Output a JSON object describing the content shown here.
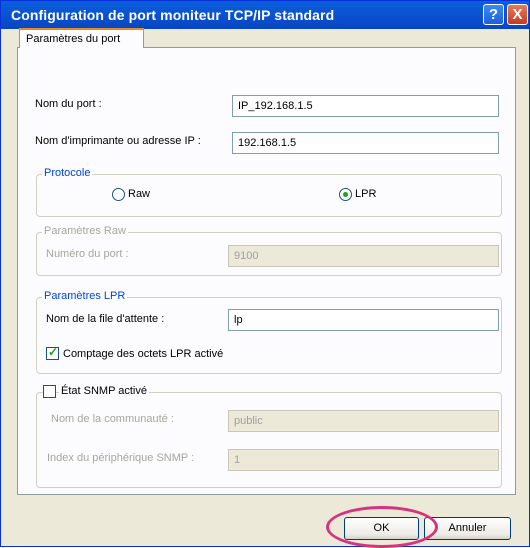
{
  "window": {
    "title": "Configuration de port moniteur TCP/IP standard",
    "help_symbol": "?",
    "close_symbol": "X"
  },
  "tab": {
    "label": "Paramètres du port"
  },
  "port": {
    "name_label": "Nom du port :",
    "name_value": "IP_192.168.1.5",
    "address_label": "Nom d'imprimante ou adresse IP :",
    "address_value": "192.168.1.5"
  },
  "protocol": {
    "legend": "Protocole",
    "raw_label": "Raw",
    "lpr_label": "LPR",
    "selected": "LPR"
  },
  "raw_settings": {
    "legend": "Paramètres Raw",
    "port_number_label": "Numéro du port :",
    "port_number_value": "9100"
  },
  "lpr_settings": {
    "legend": "Paramètres LPR",
    "queue_label": "Nom de la file d'attente :",
    "queue_value": "lp",
    "byte_count_label": "Comptage des octets LPR activé",
    "byte_count_checked": true
  },
  "snmp": {
    "enabled_label": "État SNMP activé",
    "enabled_checked": false,
    "community_label": "Nom de la communauté :",
    "community_value": "public",
    "device_index_label": "Index du périphérique SNMP :",
    "device_index_value": "1"
  },
  "buttons": {
    "ok": "OK",
    "cancel": "Annuler"
  },
  "colors": {
    "titlebar": "#0a5fdb",
    "accent_tab": "#e68b2c",
    "highlight": "#d6327e",
    "group_legend": "#0046d5"
  }
}
